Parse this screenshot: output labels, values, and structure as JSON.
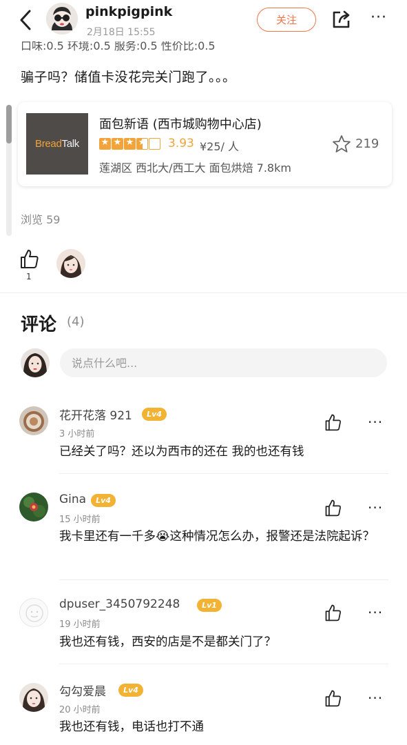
{
  "header": {
    "username": "pinkpigpink",
    "post_time": "2月18日  15:55",
    "follow_label": "关注",
    "more_glyph": "···"
  },
  "post": {
    "ratings_line": "口味:0.5  环境:0.5  服务:0.5  性价比:0.5",
    "text": "骗子吗？储值卡没花完关门跑了。。。",
    "views": "浏览 59",
    "like_count": "1"
  },
  "shop": {
    "logo_part1": "Bread",
    "logo_part2": "Talk",
    "name": "面包新语 (西市城购物中心店)",
    "rating_value": 3.5,
    "score": "3.93",
    "price": "¥25/ 人",
    "favorites": "219",
    "meta": "莲湖区 西北大/西工大 面包烘焙  7.8km"
  },
  "comments_section": {
    "title": "评论",
    "count": "(4)",
    "input_placeholder": "说点什么吧..."
  },
  "comments": [
    {
      "name": "花开花落 921",
      "level": "Lv4",
      "time": "3 小时前",
      "text": "已经关了吗？还以为西市的还在 我的也还有钱"
    },
    {
      "name": "Gina",
      "level": "Lv4",
      "time": "15 小时前",
      "text": "我卡里还有一千多😭这种情况怎么办，报警还是法院起诉？"
    },
    {
      "name": "dpuser_3450792248",
      "level": "Lv1",
      "time": "19 小时前",
      "text": "我也还有钱，西安的店是不是都关门了？"
    },
    {
      "name": "勾勾爱晨",
      "level": "Lv4",
      "time": "20 小时前",
      "text": "我也还有钱，电话也打不通"
    }
  ],
  "colors": {
    "accent": "#f0764a",
    "star": "#f2a33a",
    "level_badge": "#f2b233"
  },
  "icons": [
    "back-arrow-icon",
    "share-icon",
    "more-icon",
    "star-icon",
    "thumbs-up-icon"
  ]
}
